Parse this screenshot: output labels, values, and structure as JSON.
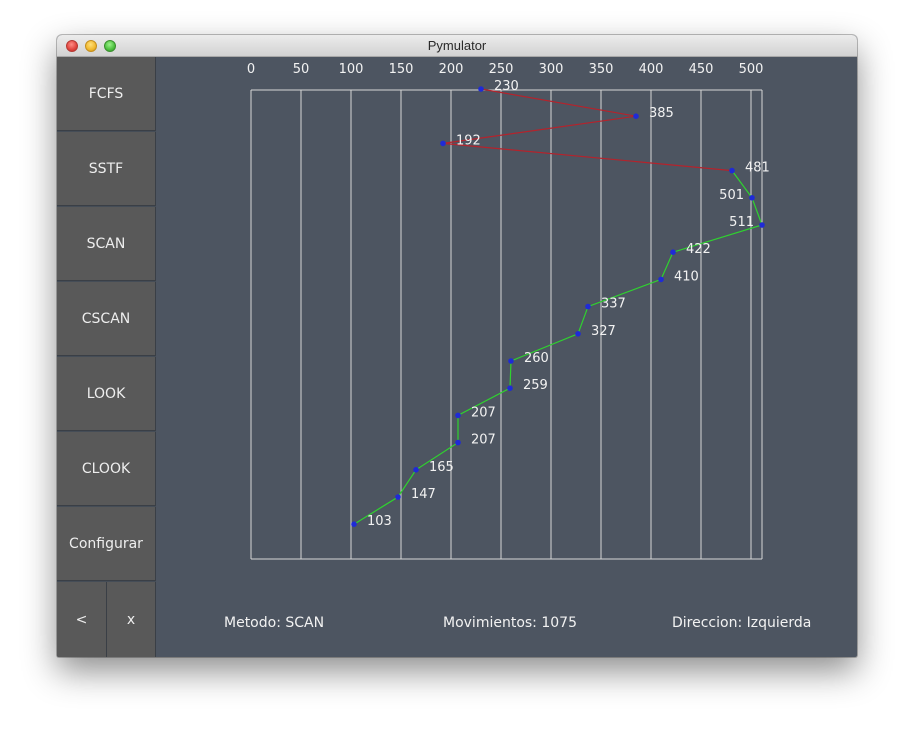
{
  "window": {
    "title": "Pymulator"
  },
  "sidebar": {
    "buttons": [
      "FCFS",
      "SSTF",
      "SCAN",
      "CSCAN",
      "LOOK",
      "CLOOK",
      "Configurar"
    ],
    "back_label": "<",
    "close_label": "x"
  },
  "status": {
    "method": "Metodo: SCAN",
    "movements": "Movimientos: 1075",
    "direction": "Direccion: Izquierda"
  },
  "chart_data": {
    "type": "line",
    "x_ticks": [
      "0",
      "50",
      "100",
      "150",
      "200",
      "250",
      "300",
      "350",
      "400",
      "450",
      "500"
    ],
    "xlim": [
      0,
      511
    ],
    "grid": true,
    "series": [
      {
        "color": "#b4232c",
        "points": [
          230,
          385,
          192,
          481
        ]
      },
      {
        "color": "#2fd22f",
        "points": [
          481,
          501,
          511,
          422,
          410,
          337,
          327,
          260,
          259,
          207,
          207,
          165,
          147,
          103
        ]
      }
    ],
    "request_labels": [
      "230",
      "385",
      "192",
      "481",
      "501",
      "511",
      "422",
      "410",
      "337",
      "327",
      "260",
      "259",
      "207",
      "207",
      "165",
      "147",
      "103"
    ],
    "point_color": "#1f2bd6"
  }
}
